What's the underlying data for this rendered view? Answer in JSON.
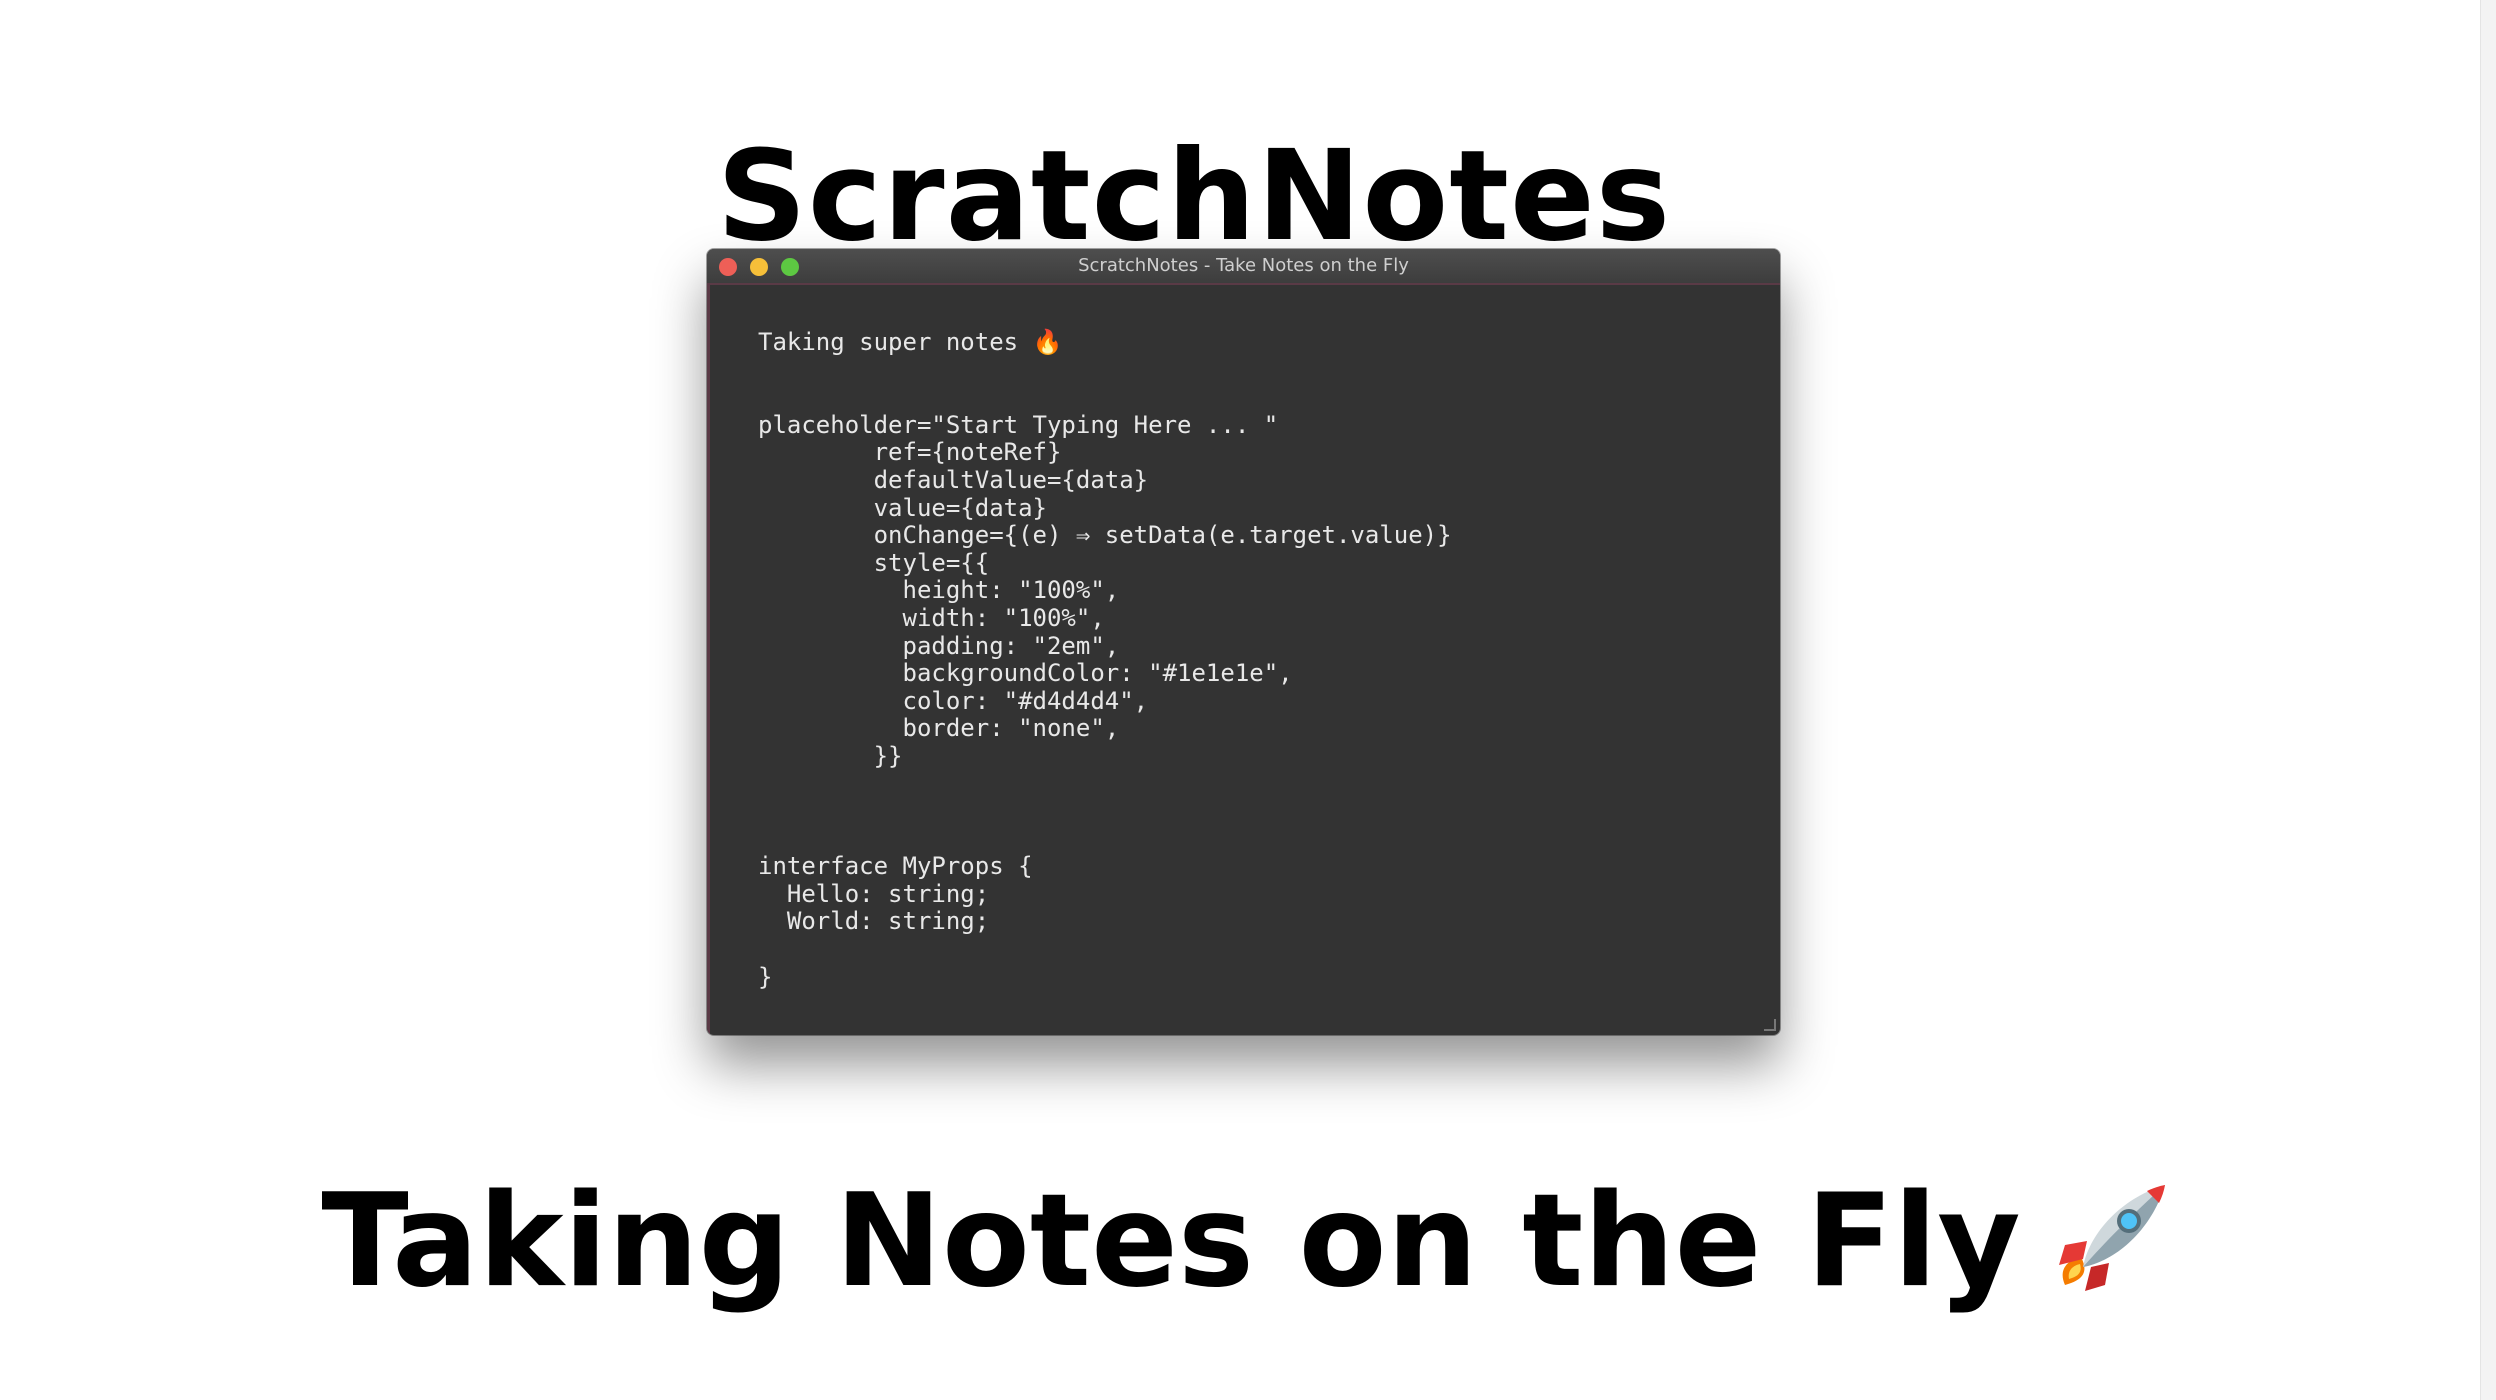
{
  "page": {
    "title": "ScratchNotes",
    "tagline": "Taking Notes on the Fly",
    "tagline_emoji": "rocket-icon"
  },
  "window": {
    "title": "ScratchNotes - Take Notes on the Fly",
    "buttons": {
      "close_color": "#ee5f57",
      "minimize_color": "#f6bf39",
      "maximize_color": "#5dc842"
    },
    "editor_background": "#333333",
    "editor_text_color": "#e8e8e8",
    "editor_content": "Taking super notes 🔥\n\n\nplaceholder=\"Start Typing Here ... \"\n        ref={noteRef}\n        defaultValue={data}\n        value={data}\n        onChange={(e) ⇒ setData(e.target.value)}\n        style={{\n          height: \"100%\",\n          width: \"100%\",\n          padding: \"2em\",\n          backgroundColor: \"#1e1e1e\",\n          color: \"#d4d4d4\",\n          border: \"none\",\n        }}\n\n\n\ninterface MyProps {\n  Hello: string;\n  World: string;\n\n}"
  }
}
